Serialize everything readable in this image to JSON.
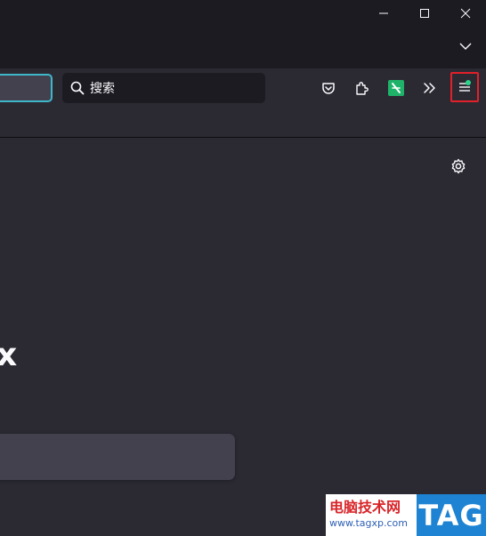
{
  "toolbar": {
    "search_placeholder": "搜索"
  },
  "content": {
    "brand_fragment": "x"
  },
  "watermark": {
    "title": "电脑技术网",
    "url": "www.tagxp.com",
    "tag": "TAG"
  },
  "colors": {
    "frame": "#1c1b22",
    "toolbar": "#2b2a33",
    "urlbar_focus": "#3fb7c9",
    "menu_highlight": "#e2202a",
    "update_dot": "#2ad58a",
    "watermark_red": "#d8252a",
    "watermark_blue": "#1e83d2"
  }
}
